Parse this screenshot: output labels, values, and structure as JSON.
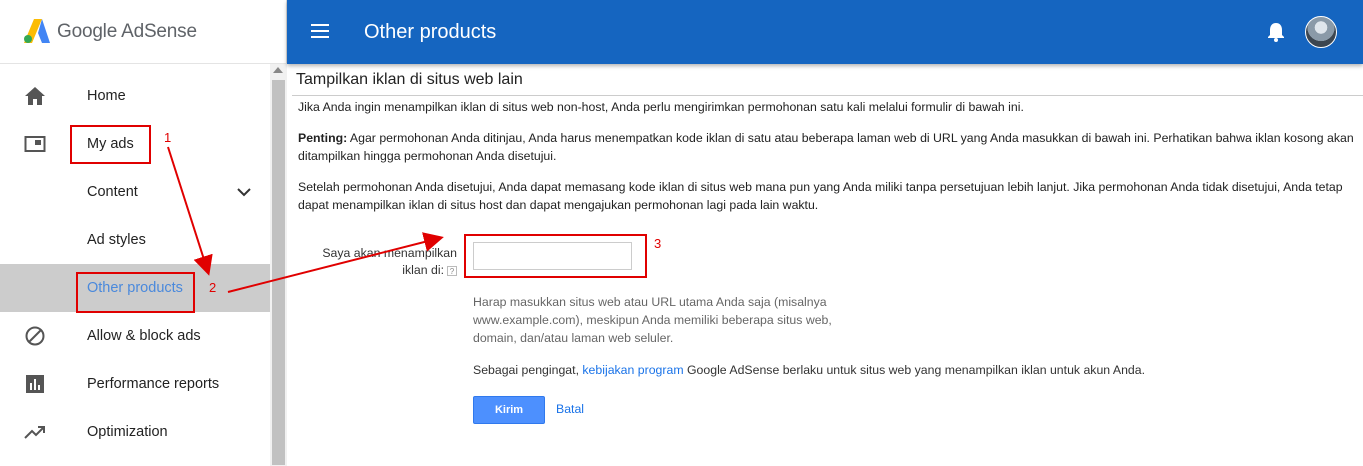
{
  "brand": {
    "name": "Google AdSense"
  },
  "topbar": {
    "title": "Other products"
  },
  "sidebar": {
    "items": [
      {
        "label": "Home",
        "icon": "home-icon"
      },
      {
        "label": "My ads",
        "icon": "ads-icon"
      },
      {
        "label": "Content",
        "icon": ""
      },
      {
        "label": "Ad styles",
        "icon": ""
      },
      {
        "label": "Other products",
        "icon": ""
      },
      {
        "label": "Allow & block ads",
        "icon": "block-icon"
      },
      {
        "label": "Performance reports",
        "icon": "bar-chart-icon"
      },
      {
        "label": "Optimization",
        "icon": "trending-up-icon"
      }
    ]
  },
  "main": {
    "section_title": "Tampilkan iklan di situs web lain",
    "intro": "Jika Anda ingin menampilkan iklan di situs web non-host, Anda perlu mengirimkan permohonan satu kali melalui formulir di bawah ini.",
    "important_label": "Penting:",
    "important_text": " Agar permohonan Anda ditinjau, Anda harus menempatkan kode iklan di satu atau beberapa laman web di URL yang Anda masukkan di bawah ini. Perhatikan bahwa iklan kosong akan ditampilkan hingga permohonan Anda disetujui.",
    "after_approval": "Setelah permohonan Anda disetujui, Anda dapat memasang kode iklan di situs web mana pun yang Anda miliki tanpa persetujuan lebih lanjut. Jika permohonan Anda tidak disetujui, Anda tetap dapat menampilkan iklan di situs host dan dapat mengajukan permohonan lagi pada lain waktu.",
    "form_label_line1": "Saya akan menampilkan",
    "form_label_line2": "iklan di:",
    "help_mark": "?",
    "site_value": "",
    "hint": "Harap masukkan situs web atau URL utama Anda saja (misalnya www.example.com), meskipun Anda memiliki beberapa situs web, domain, dan/atau laman web seluler.",
    "reminder_before": "Sebagai pengingat, ",
    "reminder_link": "kebijakan program",
    "reminder_after": " Google AdSense berlaku untuk situs web yang menampilkan iklan untuk akun Anda.",
    "submit_label": "Kirim",
    "cancel_label": "Batal"
  },
  "annotations": {
    "n1": "1",
    "n2": "2",
    "n3": "3",
    "color": "#e00000"
  },
  "colors": {
    "topbar": "#1565c0",
    "accent": "#4a89dc",
    "button": "#4d90fe"
  }
}
